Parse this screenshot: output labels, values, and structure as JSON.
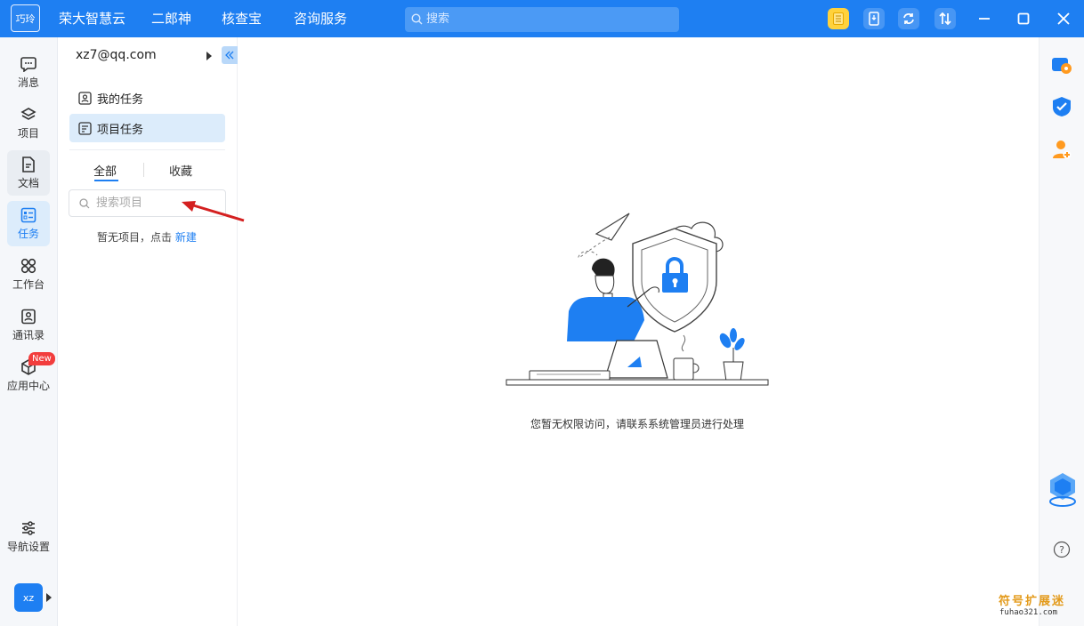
{
  "app": {
    "logo_text": "巧玲"
  },
  "topnav": [
    "荣大智慧云",
    "二郎神",
    "核查宝",
    "咨询服务"
  ],
  "search": {
    "placeholder": "搜索"
  },
  "leftnav": [
    {
      "label": "消息",
      "icon": "message-icon"
    },
    {
      "label": "项目",
      "icon": "layers-icon"
    },
    {
      "label": "文档",
      "icon": "document-icon"
    },
    {
      "label": "任务",
      "icon": "task-icon"
    },
    {
      "label": "工作台",
      "icon": "grid-icon"
    },
    {
      "label": "通讯录",
      "icon": "contacts-icon"
    },
    {
      "label": "应用中心",
      "icon": "cube-icon",
      "badge": "New"
    },
    {
      "label": "导航设置",
      "icon": "sliders-icon"
    }
  ],
  "user": {
    "avatar": "xz"
  },
  "panel": {
    "account": "xz7@qq.com",
    "menu": [
      {
        "label": "我的任务"
      },
      {
        "label": "项目任务"
      }
    ],
    "tabs": [
      "全部",
      "收藏"
    ],
    "search_placeholder": "搜索项目",
    "empty_text": "暂无项目，点击",
    "empty_link": "新建"
  },
  "main": {
    "empty_message": "您暂无权限访问，请联系系统管理员进行处理"
  },
  "watermark": {
    "line1": "符号扩展迷",
    "line2": "fuhao321.com"
  },
  "colors": {
    "brand": "#1e7ff2",
    "active_bg": "#dcecfb"
  }
}
